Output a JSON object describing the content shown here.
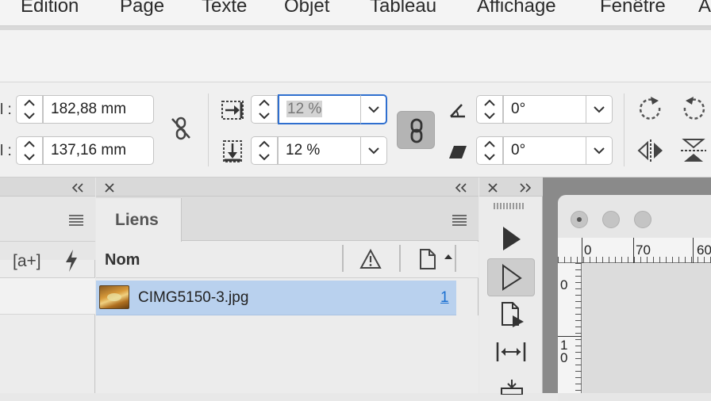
{
  "menu": [
    "Edition",
    "Page",
    "Texte",
    "Objet",
    "Tableau",
    "Affichage",
    "Fenêtre"
  ],
  "control": {
    "width_label_fragment": "l :",
    "height_label_fragment": "l :",
    "width_value": "182,88 mm",
    "height_value": "137,16 mm",
    "scale_x_value": "12 %",
    "scale_y_value": "12 %",
    "rotation_value": "0°",
    "shear_value": "0°"
  },
  "links_panel": {
    "tab_label": "Liens",
    "column_name": "Nom",
    "rows": [
      {
        "name": "CIMG5150-3.jpg",
        "page": "1"
      }
    ]
  },
  "left_panel": {
    "bracket_icon_text": "[a+]"
  },
  "ruler": {
    "h_ticks": [
      "0",
      "70",
      "60"
    ],
    "v_ticks": [
      "0",
      "1",
      "0"
    ]
  },
  "colors": {
    "selection": "#b9d1ee",
    "link_blue": "#1a6fd1",
    "focus_ring": "#2f6fcf"
  }
}
